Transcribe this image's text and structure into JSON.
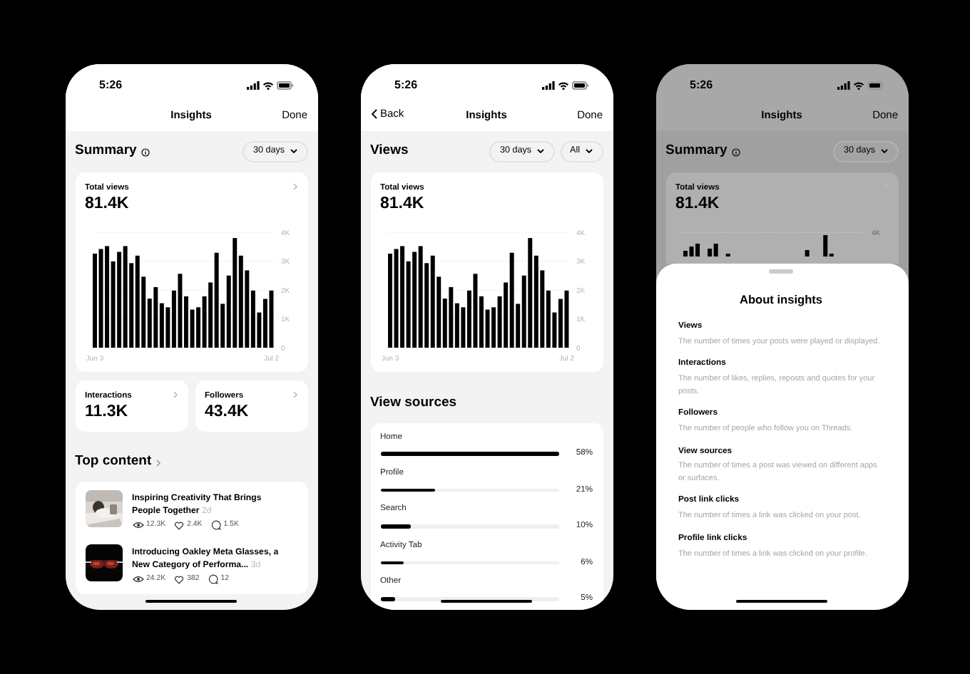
{
  "screens": [
    {
      "kind": "summary",
      "status_time": "5:26",
      "header": {
        "title": "Insights",
        "done": "Done"
      },
      "section_title": "Summary",
      "filters": [
        "30 days"
      ],
      "total_views": {
        "label": "Total views",
        "value": "81.4K",
        "chart_data": {
          "type": "bar",
          "grid": true,
          "categories": [
            "Jun 3",
            null,
            null,
            null,
            null,
            null,
            null,
            null,
            null,
            null,
            null,
            null,
            null,
            null,
            null,
            null,
            null,
            null,
            null,
            null,
            null,
            null,
            null,
            null,
            null,
            null,
            null,
            null,
            null,
            "Jul 2"
          ],
          "values": [
            3260,
            3420,
            3520,
            2990,
            3320,
            3520,
            2930,
            3190,
            2460,
            1700,
            2100,
            1540,
            1400,
            1980,
            2560,
            1780,
            1320,
            1400,
            1780,
            2260,
            3290,
            1520,
            2500,
            3800,
            3190,
            2680,
            1980,
            1220,
            1690,
            1980
          ],
          "ylim": [
            0,
            4000
          ],
          "yticks": [
            {
              "value": 0,
              "label": "0"
            },
            {
              "value": 1000,
              "label": "1K"
            },
            {
              "value": 2000,
              "label": "2K"
            },
            {
              "value": 3000,
              "label": "3K"
            },
            {
              "value": 4000,
              "label": "4K"
            }
          ]
        }
      },
      "stats": [
        {
          "label": "Interactions",
          "value": "11.3K"
        },
        {
          "label": "Followers",
          "value": "43.4K"
        }
      ],
      "top_content": {
        "title": "Top content",
        "posts": [
          {
            "title": "Inspiring Creativity That Brings People Together",
            "age": "2d",
            "views": "12.3K",
            "likes": "2.4K",
            "replies": "1.5K",
            "kind": "picture"
          },
          {
            "title": "Introducing Oakley Meta Glasses, a New Category of Performa...",
            "age": "3d",
            "views": "24.2K",
            "likes": "382",
            "replies": "12",
            "kind": "picture"
          }
        ]
      }
    },
    {
      "kind": "views",
      "status_time": "5:26",
      "header": {
        "back": "Back",
        "title": "Insights",
        "done": "Done"
      },
      "section_title": "Views",
      "filters": [
        "30 days",
        "All"
      ],
      "total_views": {
        "label": "Total views",
        "value": "81.4K",
        "chart_data": {
          "type": "bar",
          "grid": true,
          "categories": [
            "Jun 3",
            null,
            null,
            null,
            null,
            null,
            null,
            null,
            null,
            null,
            null,
            null,
            null,
            null,
            null,
            null,
            null,
            null,
            null,
            null,
            null,
            null,
            null,
            null,
            null,
            null,
            null,
            null,
            null,
            "Jul 2"
          ],
          "values": [
            3260,
            3420,
            3520,
            2990,
            3320,
            3520,
            2930,
            3190,
            2460,
            1700,
            2100,
            1540,
            1400,
            1980,
            2560,
            1780,
            1320,
            1400,
            1780,
            2260,
            3290,
            1520,
            2500,
            3800,
            3190,
            2680,
            1980,
            1220,
            1690,
            1980
          ],
          "ylim": [
            0,
            4000
          ],
          "yticks": [
            {
              "value": 0,
              "label": "0"
            },
            {
              "value": 1000,
              "label": "1K"
            },
            {
              "value": 2000,
              "label": "2K"
            },
            {
              "value": 3000,
              "label": "3K"
            },
            {
              "value": 4000,
              "label": "4K"
            }
          ]
        }
      },
      "view_sources": {
        "title": "View sources",
        "items": [
          {
            "label": "Home",
            "level": 1.0,
            "reading": "58%"
          },
          {
            "label": "Profile",
            "level": 0.31,
            "reading": "21%"
          },
          {
            "label": "Search",
            "level": 0.17,
            "reading": "10%"
          },
          {
            "label": "Activity Tab",
            "level": 0.13,
            "reading": "6%"
          },
          {
            "label": "Other",
            "level": 0.08,
            "reading": "5%"
          }
        ]
      }
    },
    {
      "kind": "sheet",
      "status_time": "5:26",
      "header": {
        "title": "Insights",
        "done": "Done"
      },
      "section_title": "Summary",
      "filters": [
        "30 days"
      ],
      "total_views": {
        "label": "Total views",
        "value": "81.4K",
        "axis_label": "4K"
      },
      "sheet": {
        "title": "About insights",
        "items": [
          {
            "title": "Views",
            "description": "The number of times your posts were played or displayed."
          },
          {
            "title": "Interactions",
            "description": "The number of likes, replies, reposts and quotes for your posts."
          },
          {
            "title": "Followers",
            "description": "The number of people who follow you on Threads."
          },
          {
            "title": "View sources",
            "description": "The number of times a post was viewed on different apps or surfaces."
          },
          {
            "title": "Post link clicks",
            "description": "The number of times a link was clicked on your post."
          },
          {
            "title": "Profile link clicks",
            "description": "The number of times a link was clicked on your profile."
          }
        ]
      }
    }
  ]
}
